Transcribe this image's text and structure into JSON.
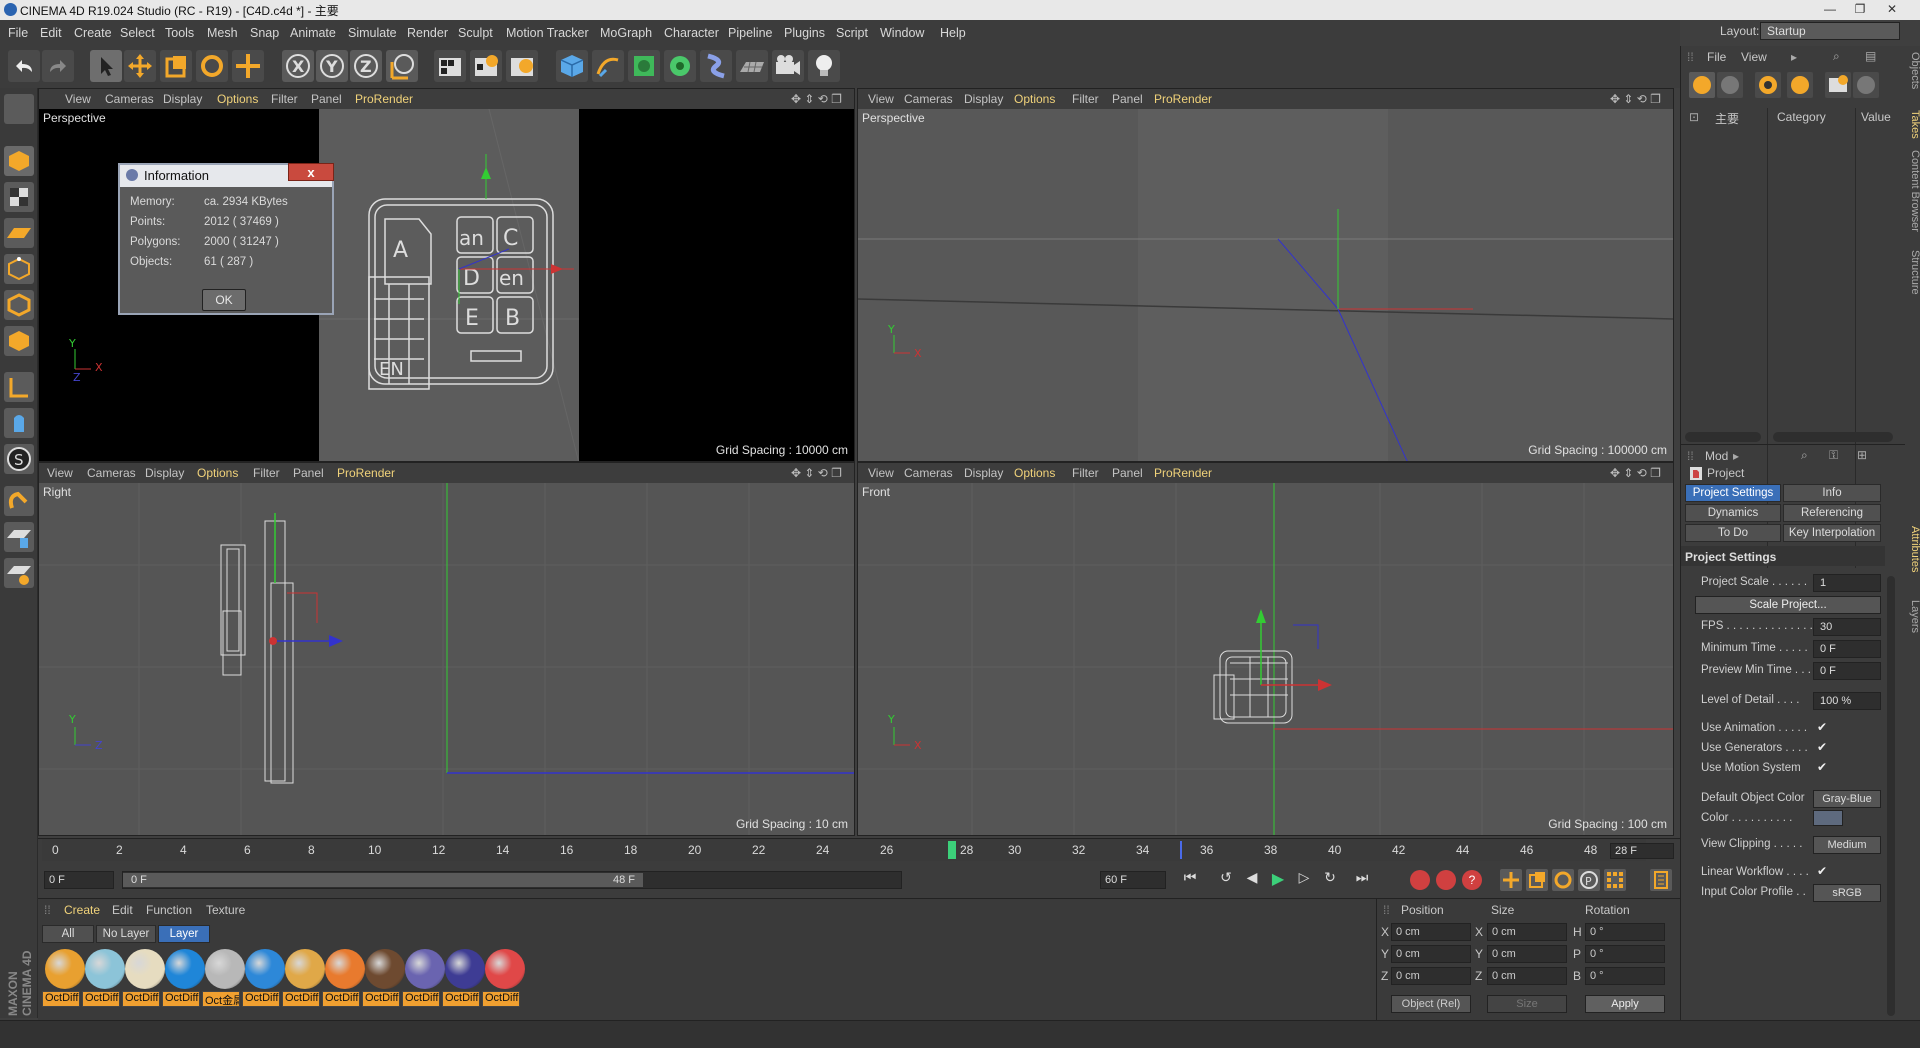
{
  "window": {
    "title": "CINEMA 4D R19.024 Studio (RC - R19) - [C4D.c4d *] - 主要",
    "controls": [
      "—",
      "❐",
      "✕"
    ]
  },
  "menu": [
    "File",
    "Edit",
    "Create",
    "Select",
    "Tools",
    "Mesh",
    "Snap",
    "Animate",
    "Simulate",
    "Render",
    "Sculpt",
    "Motion Tracker",
    "MoGraph",
    "Character",
    "Pipeline",
    "Plugins",
    "Script",
    "Window",
    "Help"
  ],
  "layout": {
    "label": "Layout:",
    "value": "Startup"
  },
  "viewports": [
    {
      "name": "Perspective",
      "grid": "Grid Spacing : 10000 cm",
      "menu": [
        "View",
        "Cameras",
        "Display",
        "Options",
        "Filter",
        "Panel",
        "ProRender"
      ]
    },
    {
      "name": "Perspective",
      "grid": "Grid Spacing : 100000 cm",
      "menu": [
        "View",
        "Cameras",
        "Display",
        "Options",
        "Filter",
        "Panel",
        "ProRender"
      ]
    },
    {
      "name": "Right",
      "grid": "Grid Spacing : 10 cm",
      "menu": [
        "View",
        "Cameras",
        "Display",
        "Options",
        "Filter",
        "Panel",
        "ProRender"
      ]
    },
    {
      "name": "Front",
      "grid": "Grid Spacing : 100 cm",
      "menu": [
        "View",
        "Cameras",
        "Display",
        "Options",
        "Filter",
        "Panel",
        "ProRender"
      ]
    }
  ],
  "info_dialog": {
    "title": "Information",
    "close": "x",
    "rows": [
      {
        "label": "Memory:",
        "value": "ca. 2934 KBytes"
      },
      {
        "label": "Points:",
        "value": "2012 ( 37469 )"
      },
      {
        "label": "Polygons:",
        "value": "2000 ( 31247 )"
      },
      {
        "label": "Objects:",
        "value": "61 ( 287 )"
      }
    ],
    "ok": "OK"
  },
  "timeline": {
    "ticks": [
      "0",
      "2",
      "4",
      "6",
      "8",
      "10",
      "12",
      "14",
      "16",
      "18",
      "20",
      "22",
      "24",
      "26",
      "28",
      "30",
      "32",
      "34",
      "36",
      "38",
      "40",
      "42",
      "44",
      "46",
      "48"
    ],
    "current": "28 F",
    "start": "0 F",
    "range_start": "0 F",
    "range_end": "48 F",
    "end": "60 F"
  },
  "materials": {
    "menu": [
      "Create",
      "Edit",
      "Function",
      "Texture"
    ],
    "filters": [
      "All",
      "No Layer",
      "Layer"
    ],
    "items": [
      {
        "name": "OctDiffu",
        "color": "#e8a030"
      },
      {
        "name": "OctDiffu",
        "color": "#8cc4d8"
      },
      {
        "name": "OctDiffu",
        "color": "#e6dcc0"
      },
      {
        "name": "OctDiffu",
        "color": "#1f86d8"
      },
      {
        "name": "Oct金属",
        "color": "#b8b8b8"
      },
      {
        "name": "OctDiffu",
        "color": "#2d88d8"
      },
      {
        "name": "OctDiffu",
        "color": "#e0a848"
      },
      {
        "name": "OctDiffu",
        "color": "#e87a2e"
      },
      {
        "name": "OctDiffu",
        "color": "#6e4a30"
      },
      {
        "name": "OctDiffu",
        "color": "#6a64b0"
      },
      {
        "name": "OctDiffu",
        "color": "#3e3c94"
      },
      {
        "name": "OctDiffu",
        "color": "#e04848"
      }
    ]
  },
  "coords": {
    "headers": [
      "Position",
      "Size",
      "Rotation"
    ],
    "rows": [
      {
        "a": "X",
        "p": "0 cm",
        "b": "X",
        "s": "0 cm",
        "c": "H",
        "r": "0 °"
      },
      {
        "a": "Y",
        "p": "0 cm",
        "b": "Y",
        "s": "0 cm",
        "c": "P",
        "r": "0 °"
      },
      {
        "a": "Z",
        "p": "0 cm",
        "b": "Z",
        "s": "0 cm",
        "c": "B",
        "r": "0 °"
      }
    ],
    "mode": "Object (Rel)",
    "size_mode": "Size",
    "apply": "Apply"
  },
  "objects_panel": {
    "menu": [
      "File",
      "View"
    ],
    "root": "主要",
    "cols": [
      "Category",
      "Value"
    ]
  },
  "attributes": {
    "mode": "Mod",
    "title": "Project",
    "tabs": [
      "Project Settings",
      "Info",
      "Dynamics",
      "Referencing",
      "To Do",
      "Key Interpolation"
    ],
    "section": "Project Settings",
    "rows": [
      {
        "label": "Project Scale . . . . . .",
        "value": "1"
      },
      {
        "label": "FPS . . . . . . . . . . . . . .",
        "value": "30"
      },
      {
        "label": "Minimum Time . . . . .",
        "value": "0 F"
      },
      {
        "label": "Preview Min Time . . .",
        "value": "0 F"
      },
      {
        "label": "Level of Detail . . . .",
        "value": "100 %"
      }
    ],
    "scale_button": "Scale Project...",
    "checks": [
      "Use Animation . . . . .",
      "Use Generators . . . .",
      "Use Motion System"
    ],
    "check_mark": "✔",
    "default_color_label": "Default Object Color",
    "default_color_value": "Gray-Blue",
    "color_label": "Color . . . . . . . . . .",
    "view_clipping_label": "View Clipping . . . . .",
    "view_clipping_value": "Medium",
    "linear_label": "Linear Workflow . . . .",
    "input_profile_label": "Input Color Profile . .",
    "input_profile_value": "sRGB"
  },
  "side_tabs": [
    "Objects",
    "Takes",
    "Content Browser",
    "Structure",
    "Attributes",
    "Layers"
  ],
  "brand": "MAXON CINEMA 4D"
}
